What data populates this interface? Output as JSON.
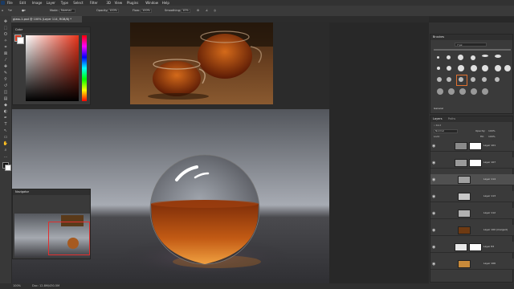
{
  "app": {
    "name": "Ps"
  },
  "menu": [
    "File",
    "Edit",
    "Image",
    "Layer",
    "Type",
    "Select",
    "Filter",
    "3D",
    "View",
    "Plugins",
    "Window",
    "Help"
  ],
  "options": {
    "opacity_label": "Opacity:",
    "opacity": "100%",
    "flow_label": "Flow:",
    "flow": "100%",
    "smoothing_label": "Smoothing:",
    "smoothing": "10%",
    "mode_label": "Mode:",
    "mode": "Normal"
  },
  "document": {
    "tab": "glass-1.psd @ 100% (Layer 114, RGB/8) *",
    "zoom": "100%",
    "doc_size": "Doc: 12.8M/430.5M"
  },
  "color_panel": {
    "title": "Color",
    "primary": "#d83a20"
  },
  "navigator_panel": {
    "title": "Navigator"
  },
  "brushes_panel": {
    "title": "Brushes",
    "size": "7 px",
    "folder": "General"
  },
  "layers_panel": {
    "tabs": [
      "Layers",
      "Paths"
    ],
    "blend": "Normal",
    "opacity_label": "Opacity:",
    "opacity": "100%",
    "lock_label": "Lock:",
    "fill_label": "Fill:",
    "fill": "100%",
    "layers": [
      {
        "name": "Layer 101",
        "thumb": "#8a8a8a",
        "mask": true,
        "selected": false
      },
      {
        "name": "Layer 107",
        "thumb": "#9a9a9a",
        "mask": true,
        "selected": false
      },
      {
        "name": "Layer 114",
        "thumb": "#a0a0a0",
        "mask": false,
        "selected": true
      },
      {
        "name": "Layer 113",
        "thumb": "#c8c8c8",
        "mask": false,
        "selected": false
      },
      {
        "name": "Layer 112",
        "thumb": "#b0b0b0",
        "mask": false,
        "selected": false
      },
      {
        "name": "Layer 100 (merged)",
        "thumb": "#6e3a12",
        "mask": false,
        "selected": false
      },
      {
        "name": "Layer 83",
        "thumb": "#e8e8e8",
        "mask": true,
        "selected": false
      },
      {
        "name": "Layer 106",
        "thumb": "#c88a3a",
        "mask": false,
        "selected": false
      }
    ]
  }
}
